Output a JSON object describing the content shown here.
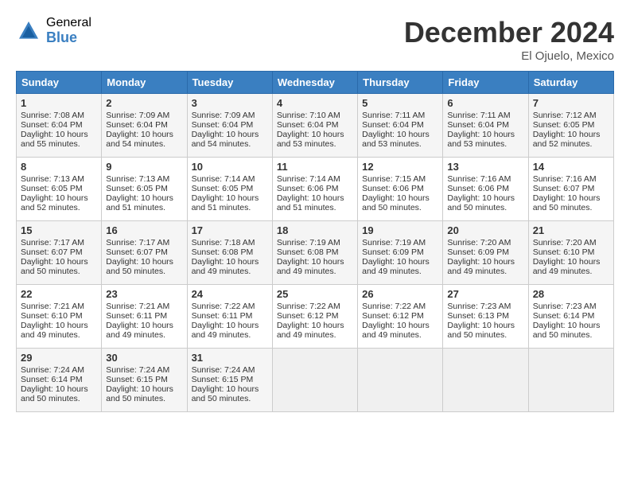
{
  "header": {
    "logo_general": "General",
    "logo_blue": "Blue",
    "month_title": "December 2024",
    "location": "El Ojuelo, Mexico"
  },
  "days_of_week": [
    "Sunday",
    "Monday",
    "Tuesday",
    "Wednesday",
    "Thursday",
    "Friday",
    "Saturday"
  ],
  "weeks": [
    [
      {
        "day": "1",
        "sunrise": "Sunrise: 7:08 AM",
        "sunset": "Sunset: 6:04 PM",
        "daylight": "Daylight: 10 hours and 55 minutes."
      },
      {
        "day": "2",
        "sunrise": "Sunrise: 7:09 AM",
        "sunset": "Sunset: 6:04 PM",
        "daylight": "Daylight: 10 hours and 54 minutes."
      },
      {
        "day": "3",
        "sunrise": "Sunrise: 7:09 AM",
        "sunset": "Sunset: 6:04 PM",
        "daylight": "Daylight: 10 hours and 54 minutes."
      },
      {
        "day": "4",
        "sunrise": "Sunrise: 7:10 AM",
        "sunset": "Sunset: 6:04 PM",
        "daylight": "Daylight: 10 hours and 53 minutes."
      },
      {
        "day": "5",
        "sunrise": "Sunrise: 7:11 AM",
        "sunset": "Sunset: 6:04 PM",
        "daylight": "Daylight: 10 hours and 53 minutes."
      },
      {
        "day": "6",
        "sunrise": "Sunrise: 7:11 AM",
        "sunset": "Sunset: 6:04 PM",
        "daylight": "Daylight: 10 hours and 53 minutes."
      },
      {
        "day": "7",
        "sunrise": "Sunrise: 7:12 AM",
        "sunset": "Sunset: 6:05 PM",
        "daylight": "Daylight: 10 hours and 52 minutes."
      }
    ],
    [
      {
        "day": "8",
        "sunrise": "Sunrise: 7:13 AM",
        "sunset": "Sunset: 6:05 PM",
        "daylight": "Daylight: 10 hours and 52 minutes."
      },
      {
        "day": "9",
        "sunrise": "Sunrise: 7:13 AM",
        "sunset": "Sunset: 6:05 PM",
        "daylight": "Daylight: 10 hours and 51 minutes."
      },
      {
        "day": "10",
        "sunrise": "Sunrise: 7:14 AM",
        "sunset": "Sunset: 6:05 PM",
        "daylight": "Daylight: 10 hours and 51 minutes."
      },
      {
        "day": "11",
        "sunrise": "Sunrise: 7:14 AM",
        "sunset": "Sunset: 6:06 PM",
        "daylight": "Daylight: 10 hours and 51 minutes."
      },
      {
        "day": "12",
        "sunrise": "Sunrise: 7:15 AM",
        "sunset": "Sunset: 6:06 PM",
        "daylight": "Daylight: 10 hours and 50 minutes."
      },
      {
        "day": "13",
        "sunrise": "Sunrise: 7:16 AM",
        "sunset": "Sunset: 6:06 PM",
        "daylight": "Daylight: 10 hours and 50 minutes."
      },
      {
        "day": "14",
        "sunrise": "Sunrise: 7:16 AM",
        "sunset": "Sunset: 6:07 PM",
        "daylight": "Daylight: 10 hours and 50 minutes."
      }
    ],
    [
      {
        "day": "15",
        "sunrise": "Sunrise: 7:17 AM",
        "sunset": "Sunset: 6:07 PM",
        "daylight": "Daylight: 10 hours and 50 minutes."
      },
      {
        "day": "16",
        "sunrise": "Sunrise: 7:17 AM",
        "sunset": "Sunset: 6:07 PM",
        "daylight": "Daylight: 10 hours and 50 minutes."
      },
      {
        "day": "17",
        "sunrise": "Sunrise: 7:18 AM",
        "sunset": "Sunset: 6:08 PM",
        "daylight": "Daylight: 10 hours and 49 minutes."
      },
      {
        "day": "18",
        "sunrise": "Sunrise: 7:19 AM",
        "sunset": "Sunset: 6:08 PM",
        "daylight": "Daylight: 10 hours and 49 minutes."
      },
      {
        "day": "19",
        "sunrise": "Sunrise: 7:19 AM",
        "sunset": "Sunset: 6:09 PM",
        "daylight": "Daylight: 10 hours and 49 minutes."
      },
      {
        "day": "20",
        "sunrise": "Sunrise: 7:20 AM",
        "sunset": "Sunset: 6:09 PM",
        "daylight": "Daylight: 10 hours and 49 minutes."
      },
      {
        "day": "21",
        "sunrise": "Sunrise: 7:20 AM",
        "sunset": "Sunset: 6:10 PM",
        "daylight": "Daylight: 10 hours and 49 minutes."
      }
    ],
    [
      {
        "day": "22",
        "sunrise": "Sunrise: 7:21 AM",
        "sunset": "Sunset: 6:10 PM",
        "daylight": "Daylight: 10 hours and 49 minutes."
      },
      {
        "day": "23",
        "sunrise": "Sunrise: 7:21 AM",
        "sunset": "Sunset: 6:11 PM",
        "daylight": "Daylight: 10 hours and 49 minutes."
      },
      {
        "day": "24",
        "sunrise": "Sunrise: 7:22 AM",
        "sunset": "Sunset: 6:11 PM",
        "daylight": "Daylight: 10 hours and 49 minutes."
      },
      {
        "day": "25",
        "sunrise": "Sunrise: 7:22 AM",
        "sunset": "Sunset: 6:12 PM",
        "daylight": "Daylight: 10 hours and 49 minutes."
      },
      {
        "day": "26",
        "sunrise": "Sunrise: 7:22 AM",
        "sunset": "Sunset: 6:12 PM",
        "daylight": "Daylight: 10 hours and 49 minutes."
      },
      {
        "day": "27",
        "sunrise": "Sunrise: 7:23 AM",
        "sunset": "Sunset: 6:13 PM",
        "daylight": "Daylight: 10 hours and 50 minutes."
      },
      {
        "day": "28",
        "sunrise": "Sunrise: 7:23 AM",
        "sunset": "Sunset: 6:14 PM",
        "daylight": "Daylight: 10 hours and 50 minutes."
      }
    ],
    [
      {
        "day": "29",
        "sunrise": "Sunrise: 7:24 AM",
        "sunset": "Sunset: 6:14 PM",
        "daylight": "Daylight: 10 hours and 50 minutes."
      },
      {
        "day": "30",
        "sunrise": "Sunrise: 7:24 AM",
        "sunset": "Sunset: 6:15 PM",
        "daylight": "Daylight: 10 hours and 50 minutes."
      },
      {
        "day": "31",
        "sunrise": "Sunrise: 7:24 AM",
        "sunset": "Sunset: 6:15 PM",
        "daylight": "Daylight: 10 hours and 50 minutes."
      },
      null,
      null,
      null,
      null
    ]
  ]
}
